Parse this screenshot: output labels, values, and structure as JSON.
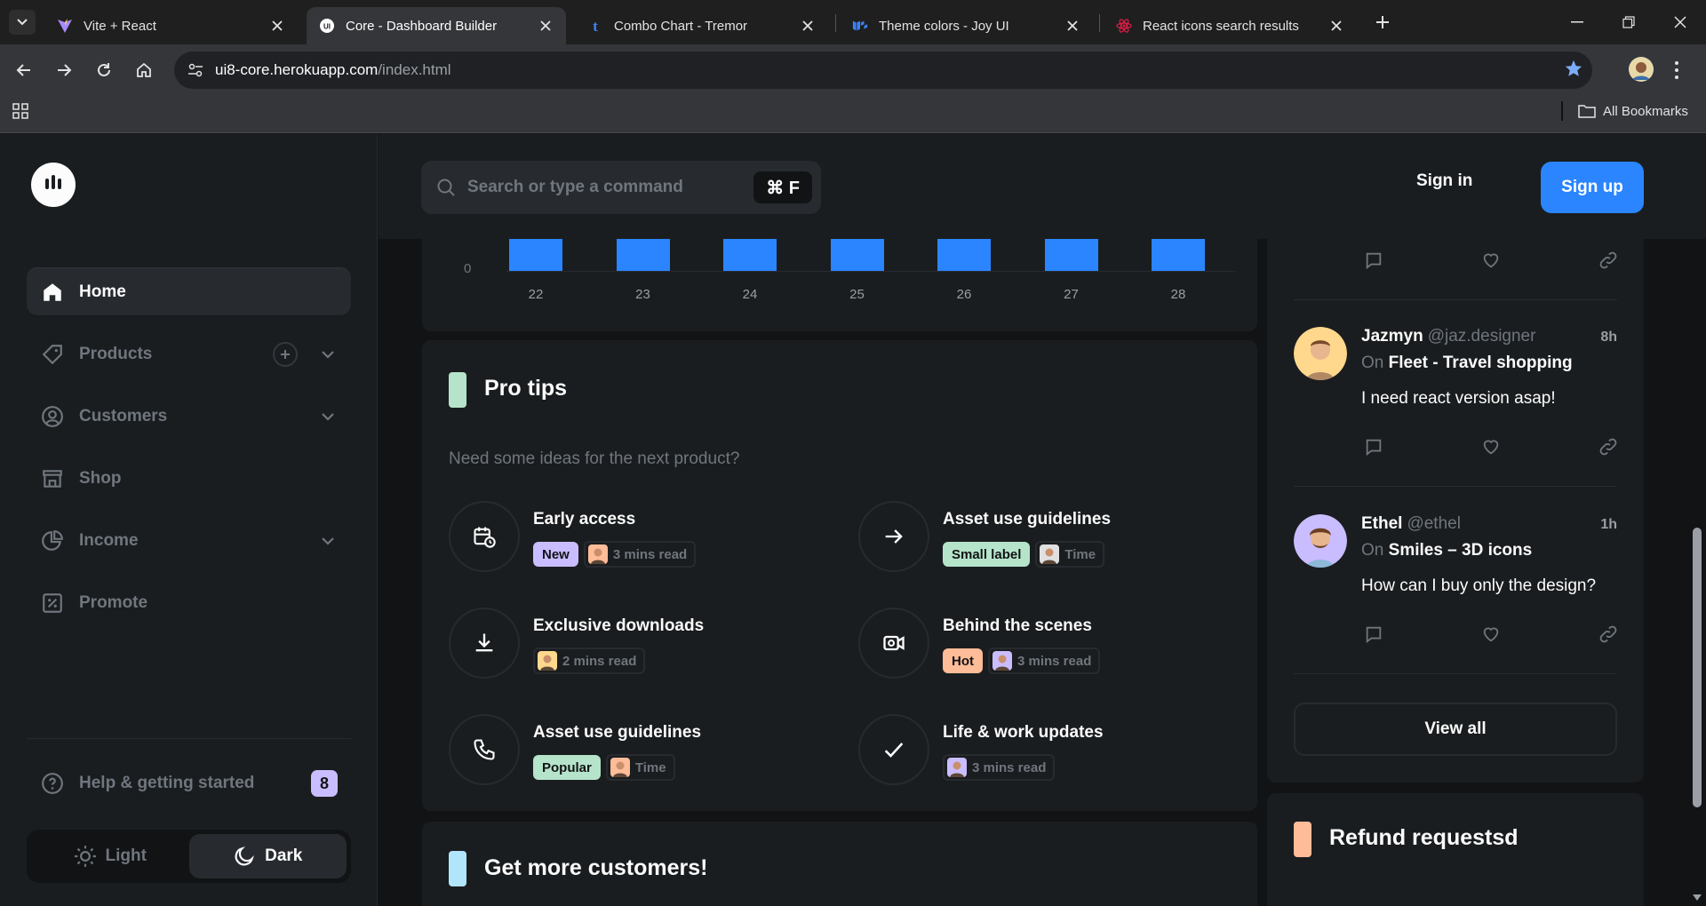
{
  "browser": {
    "tabs": [
      {
        "title": "Vite + React",
        "active": false
      },
      {
        "title": "Core - Dashboard Builder",
        "active": true
      },
      {
        "title": "Combo Chart - Tremor",
        "active": false
      },
      {
        "title": "Theme colors - Joy UI",
        "active": false
      },
      {
        "title": "React icons search results",
        "active": false
      }
    ],
    "url_host": "ui8-core.herokuapp.com",
    "url_path": "/index.html",
    "bookmarks_label": "All Bookmarks"
  },
  "sidebar": {
    "items": [
      {
        "label": "Home",
        "icon": "home-icon",
        "active": true
      },
      {
        "label": "Products",
        "icon": "diamond-icon",
        "active": false
      },
      {
        "label": "Customers",
        "icon": "user-circle-icon",
        "active": false
      },
      {
        "label": "Shop",
        "icon": "store-icon",
        "active": false
      },
      {
        "label": "Income",
        "icon": "pie-chart-icon",
        "active": false
      },
      {
        "label": "Promote",
        "icon": "promote-icon",
        "active": false
      }
    ],
    "help_label": "Help & getting started",
    "help_count": "8",
    "theme": {
      "light": "Light",
      "dark": "Dark",
      "selected": "Dark"
    }
  },
  "header": {
    "search_placeholder": "Search or type a command",
    "shortcut": "⌘ F",
    "signin": "Sign in",
    "signup": "Sign up"
  },
  "chart_data": {
    "type": "bar",
    "categories": [
      "22",
      "23",
      "24",
      "25",
      "26",
      "27",
      "28"
    ],
    "y_tick_visible": "0",
    "bar_color": "#2a85ff"
  },
  "pro_tips": {
    "title": "Pro tips",
    "marker_color": "#b5e4ca",
    "subtitle": "Need some ideas for the next product?",
    "tips": [
      {
        "title": "Early access",
        "icon": "calendar-clock-icon",
        "badge": "New",
        "badge_color": "#cabdff",
        "read": "3 mins read"
      },
      {
        "title": "Asset use guidelines",
        "icon": "arrow-right-icon",
        "badge": "Small label",
        "badge_color": "#b5e4ca",
        "read": "Time"
      },
      {
        "title": "Exclusive downloads",
        "icon": "download-icon",
        "badge": "",
        "badge_color": "",
        "read": "2 mins read"
      },
      {
        "title": "Behind the scenes",
        "icon": "video-camera-icon",
        "badge": "Hot",
        "badge_color": "#ffbc99",
        "read": "3 mins read"
      },
      {
        "title": "Asset use guidelines",
        "icon": "phone-icon",
        "badge": "Popular",
        "badge_color": "#b5e4ca",
        "read": "Time"
      },
      {
        "title": "Life & work updates",
        "icon": "check-icon",
        "badge": "",
        "badge_color": "",
        "read": "3 mins read"
      }
    ]
  },
  "more_customers": {
    "title": "Get more customers!",
    "marker_color": "#b1e5fc"
  },
  "comments": {
    "items": [
      {
        "name": "Jazmyn",
        "handle": "@jaz.designer",
        "time": "8h",
        "on_prefix": "On",
        "product": "Fleet - Travel shopping",
        "text": "I need react version asap!"
      },
      {
        "name": "Ethel",
        "handle": "@ethel",
        "time": "1h",
        "on_prefix": "On",
        "product": "Smiles – 3D icons",
        "text": "How can I buy only the design?"
      }
    ],
    "view_all": "View all"
  },
  "refund": {
    "title": "Refund requestsd",
    "marker_color": "#ffbc99"
  }
}
